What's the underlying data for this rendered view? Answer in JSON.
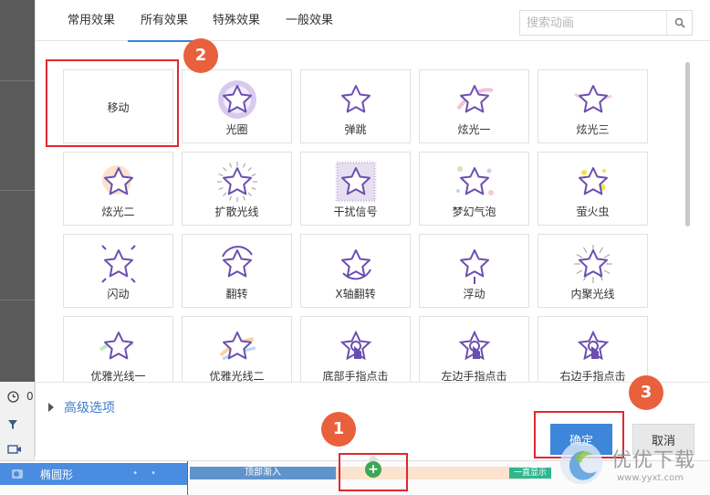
{
  "tabs": [
    {
      "label": "常用效果",
      "active": false
    },
    {
      "label": "所有效果",
      "active": true
    },
    {
      "label": "特殊效果",
      "active": false
    },
    {
      "label": "一般效果",
      "active": false
    }
  ],
  "search": {
    "placeholder": "搜索动画",
    "icon": "search-icon"
  },
  "effects": [
    {
      "label": "移动",
      "icon": "",
      "selected": true
    },
    {
      "label": "光圈",
      "icon": "star-halo-icon"
    },
    {
      "label": "弹跳",
      "icon": "star-bounce-icon"
    },
    {
      "label": "炫光一",
      "icon": "star-glare-1-icon"
    },
    {
      "label": "炫光三",
      "icon": "star-glare-3-icon"
    },
    {
      "label": "炫光二",
      "icon": "star-glare-2-icon"
    },
    {
      "label": "扩散光线",
      "icon": "star-diffuse-icon"
    },
    {
      "label": "干扰信号",
      "icon": "star-noise-icon"
    },
    {
      "label": "梦幻气泡",
      "icon": "star-bubble-icon"
    },
    {
      "label": "萤火虫",
      "icon": "star-firefly-icon"
    },
    {
      "label": "闪动",
      "icon": "star-flash-icon"
    },
    {
      "label": "翻转",
      "icon": "star-flip-icon"
    },
    {
      "label": "X轴翻转",
      "icon": "star-xflip-icon"
    },
    {
      "label": "浮动",
      "icon": "star-float-icon"
    },
    {
      "label": "内聚光线",
      "icon": "star-converge-icon"
    },
    {
      "label": "优雅光线一",
      "icon": "star-elegant-1-icon"
    },
    {
      "label": "优雅光线二",
      "icon": "star-elegant-2-icon"
    },
    {
      "label": "底部手指点击",
      "icon": "finger-bottom-icon"
    },
    {
      "label": "左边手指点击",
      "icon": "finger-left-icon"
    },
    {
      "label": "右边手指点击",
      "icon": "finger-right-icon"
    }
  ],
  "footer": {
    "advanced_label": "高级选项",
    "ok_label": "确定",
    "cancel_label": "取消"
  },
  "badges": [
    "1",
    "2",
    "3"
  ],
  "app": {
    "row_value": "0",
    "layer_name": "椭圆形",
    "bar_enter": "顶部渐入",
    "bar_always": "一直显示"
  },
  "watermark": {
    "title": "优优下载",
    "url": "www.yyxt.com"
  },
  "colors": {
    "accent": "#3d86d9",
    "highlight": "#e0282e",
    "badge": "#e8603c",
    "star": "#6a4fb0"
  }
}
